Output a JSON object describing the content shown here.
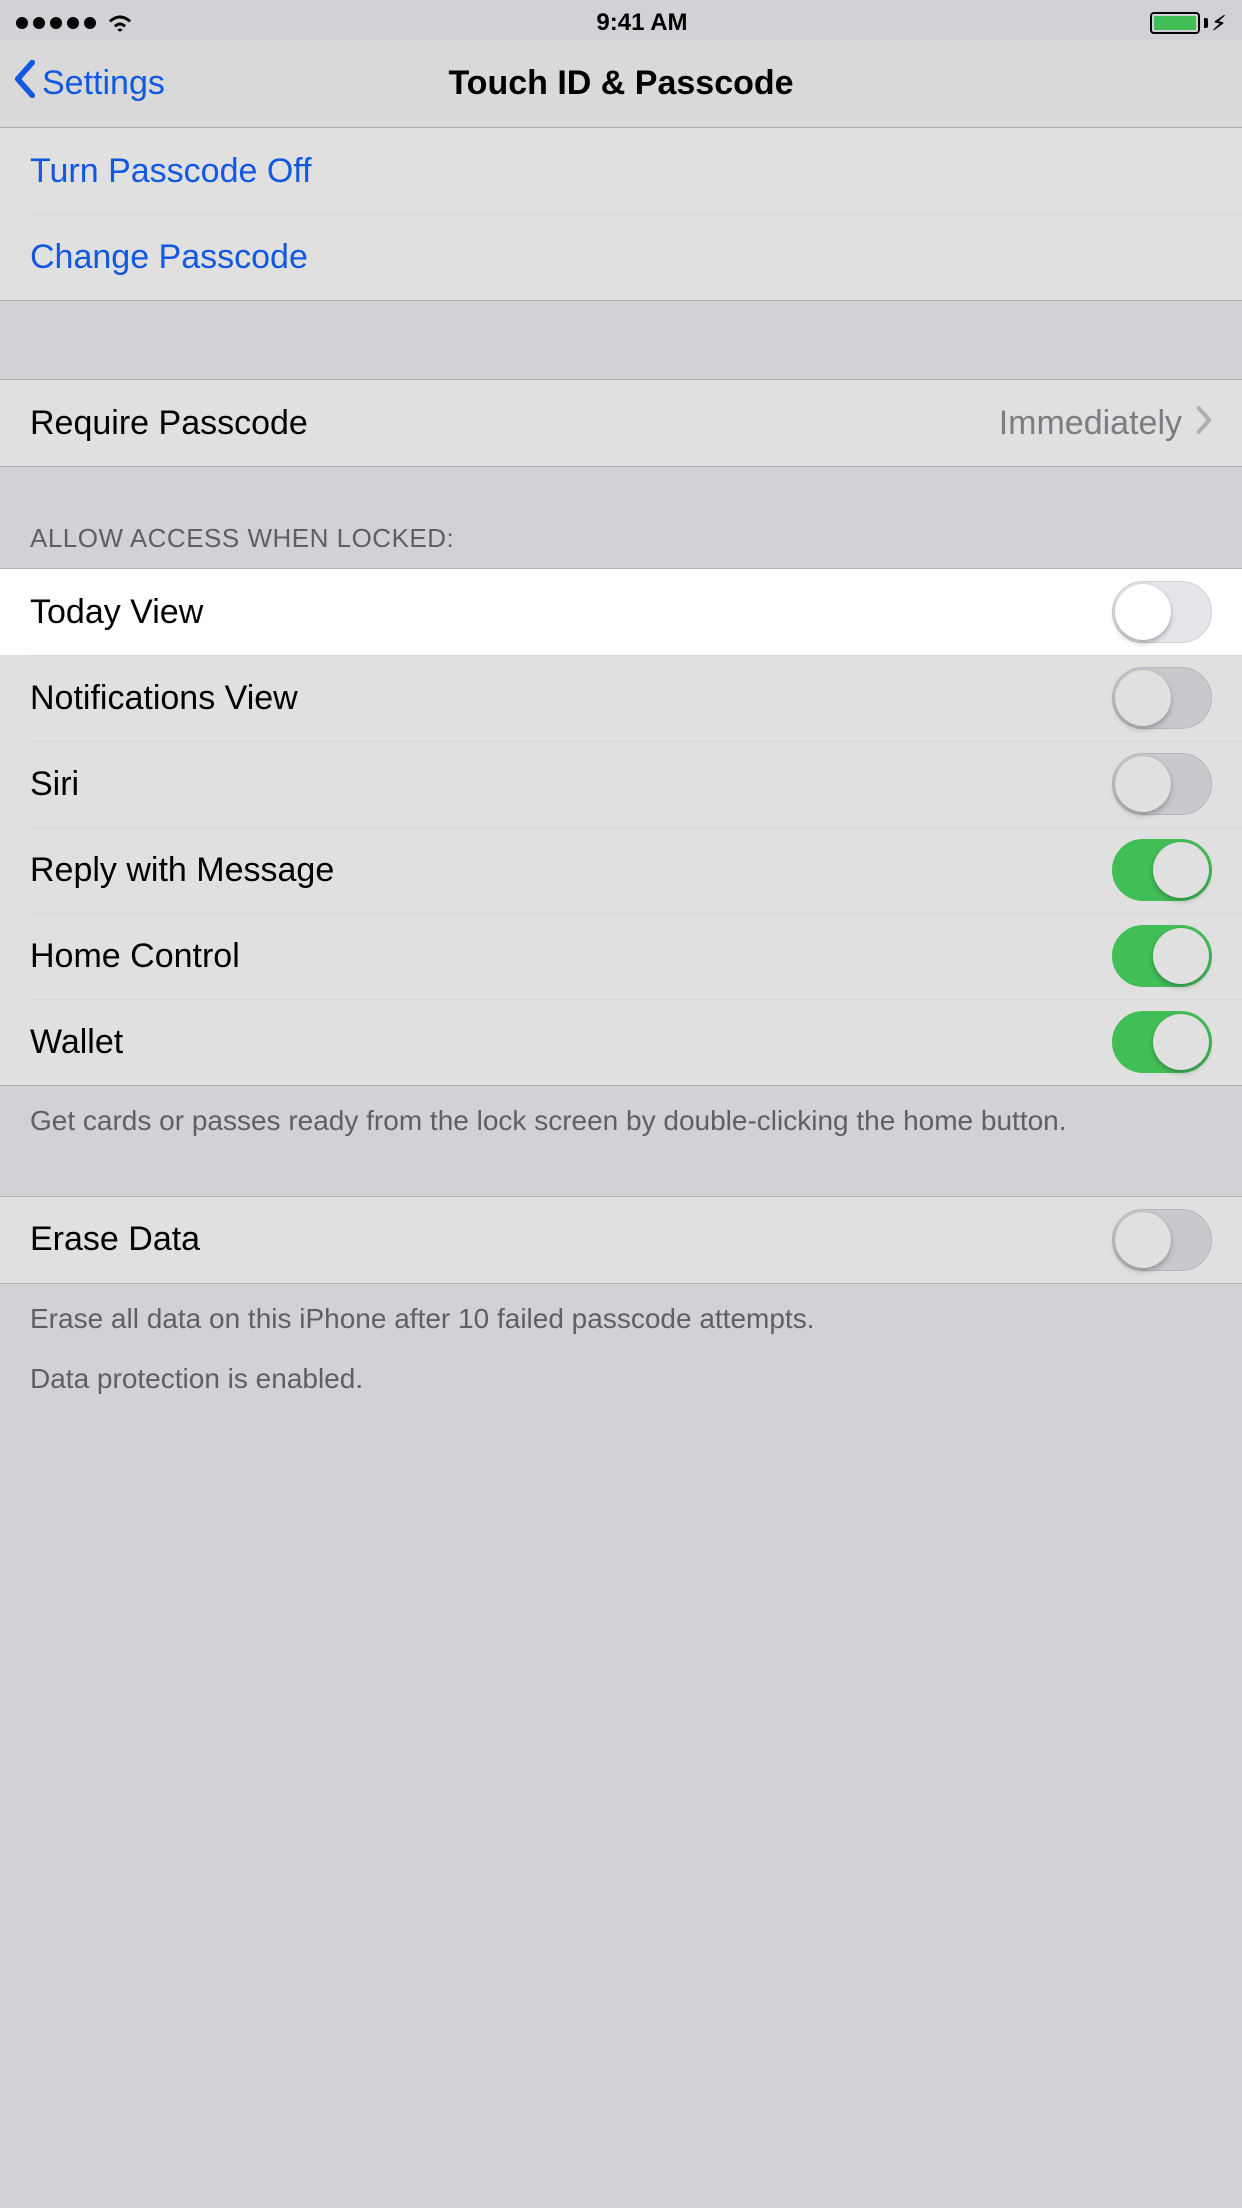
{
  "status": {
    "time": "9:41 AM"
  },
  "nav": {
    "back": "Settings",
    "title": "Touch ID & Passcode"
  },
  "passcode": {
    "turn_off": "Turn Passcode Off",
    "change": "Change Passcode"
  },
  "require": {
    "label": "Require Passcode",
    "value": "Immediately"
  },
  "allow_header": "ALLOW ACCESS WHEN LOCKED:",
  "access": {
    "today": {
      "label": "Today View",
      "on": false
    },
    "notifications": {
      "label": "Notifications View",
      "on": false
    },
    "siri": {
      "label": "Siri",
      "on": false
    },
    "reply": {
      "label": "Reply with Message",
      "on": true
    },
    "home": {
      "label": "Home Control",
      "on": true
    },
    "wallet": {
      "label": "Wallet",
      "on": true
    }
  },
  "access_footer": "Get cards or passes ready from the lock screen by double-clicking the home button.",
  "erase": {
    "label": "Erase Data",
    "on": false
  },
  "erase_footer1": "Erase all data on this iPhone after 10 failed passcode attempts.",
  "erase_footer2": "Data protection is enabled."
}
